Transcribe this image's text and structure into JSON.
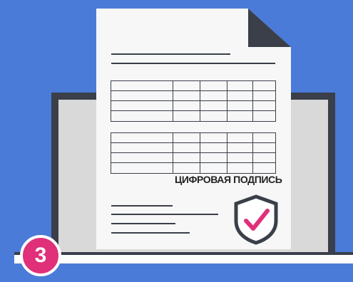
{
  "signature_label": "ЦИФРОВАЯ ПОДПИСЬ",
  "step_number": "3",
  "colors": {
    "background": "#4a7bd8",
    "document": "#f7f7f7",
    "ink": "#3a3f4a",
    "accent": "#e0307a"
  },
  "icons": [
    "document-icon",
    "laptop-icon",
    "shield-check-icon"
  ]
}
